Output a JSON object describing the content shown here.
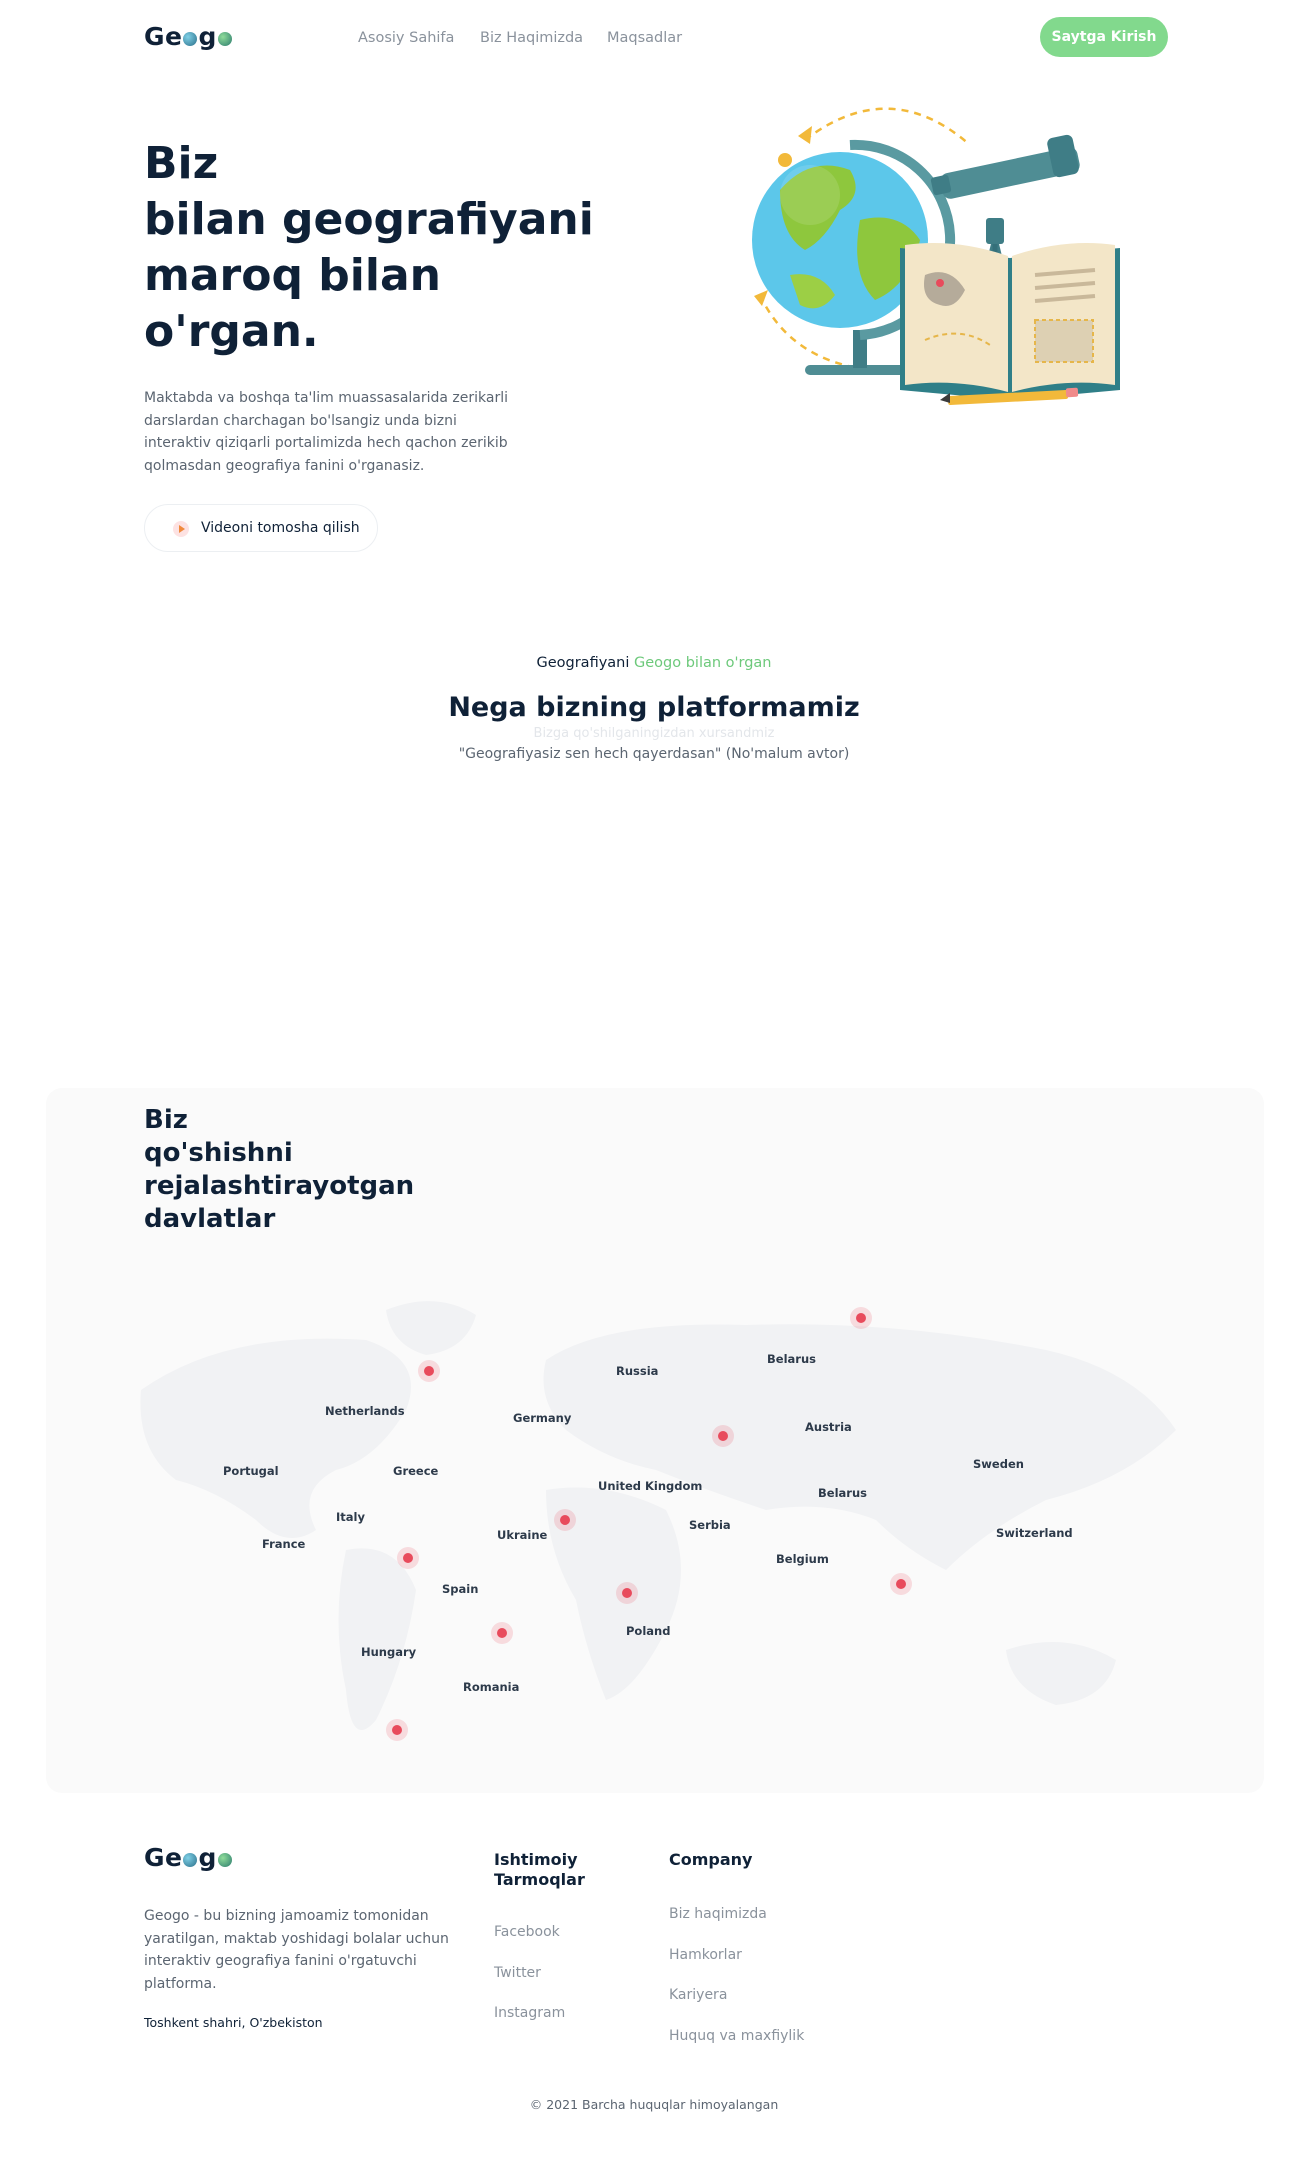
{
  "header": {
    "logo": {
      "pre": "Ge",
      "mid": "g"
    },
    "nav": [
      {
        "label": "Asosiy Sahifa"
      },
      {
        "label": "Biz Haqimizda"
      },
      {
        "label": "Maqsadlar"
      }
    ],
    "cta_label": "Saytga Kirish"
  },
  "hero": {
    "title_lines": [
      "Biz",
      "bilan geografiyani",
      "maroq bilan",
      "o'rgan."
    ],
    "description": "Maktabda va boshqa ta'lim muassasalarida zerikarli darslardan charchagan bo'lsangiz unda bizni interaktiv qiziqarli portalimizda hech qachon zerikib qolmasdan geografiya fanini o'rganasiz.",
    "video_button_label": "Videoni tomosha qilish"
  },
  "why": {
    "kicker": "Geografiyani",
    "kicker_accent": "Geogo bilan o'rgan",
    "title": "Nega bizning platformamiz",
    "ghost_subtitle": "Bizga qo'shilganingizdan xursandmiz",
    "quote": "\"Geografiyasiz sen hech qayerdasan\" (No'malum avtor)"
  },
  "countries": {
    "title_lines": [
      "Biz",
      "qo'shishni",
      "rejalashtirayotgan",
      "davlatlar"
    ],
    "labels": [
      "Russia",
      "Belarus",
      "Netherlands",
      "Germany",
      "Austria",
      "Portugal",
      "Greece",
      "United Kingdom",
      "Sweden",
      "Belarus",
      "Italy",
      "Ukraine",
      "Serbia",
      "Switzerland",
      "France",
      "Belgium",
      "Spain",
      "Poland",
      "Hungary",
      "Romania"
    ]
  },
  "footer": {
    "description": "Geogo - bu bizning jamoamiz tomonidan yaratilgan, maktab yoshidagi bolalar uchun interaktiv geografiya fanini o'rgatuvchi platforma.",
    "address": "Toshkent shahri, O'zbekiston",
    "social": {
      "heading_lines": [
        "Ishtimoiy",
        "Tarmoqlar"
      ],
      "links": [
        "Facebook",
        "Twitter",
        "Instagram"
      ]
    },
    "company": {
      "heading": "Company",
      "links": [
        "Biz haqimizda",
        "Hamkorlar",
        "Kariyera",
        "Huquq va maxfiylik"
      ]
    },
    "copyright": "© 2021 Barcha huquqlar himoyalangan"
  },
  "colors": {
    "accent": "#82d98d",
    "text": "#0f2137",
    "muted": "#8a929c",
    "marker": "#e84b5c"
  }
}
